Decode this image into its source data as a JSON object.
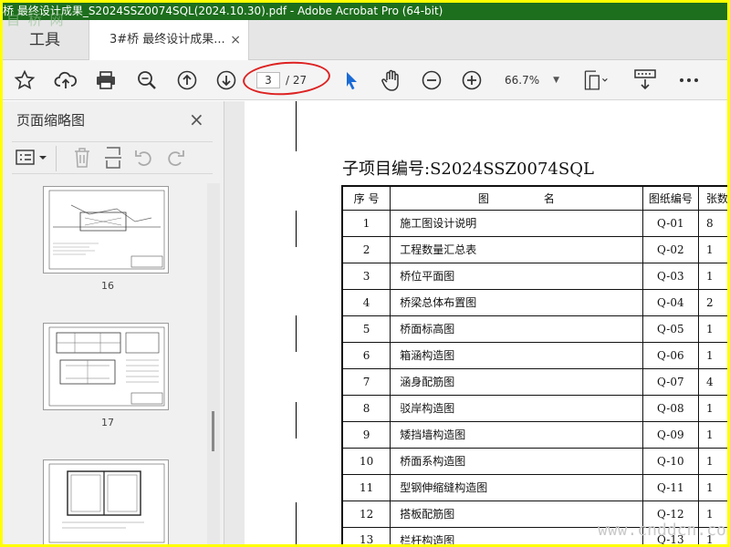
{
  "window": {
    "title": "桥 最终设计成果_S2024SSZ0074SQL(2024.10.30).pdf - Adobe Acrobat Pro (64-bit)",
    "watermark_top": "自 桥 网"
  },
  "tabs": {
    "tools_label": "工具",
    "doc_label": "3#桥 最终设计成果...",
    "close": "×"
  },
  "toolbar": {
    "page_current": "3",
    "page_total": "/ 27",
    "zoom": "66.7%",
    "highlight_color": "#dd2222",
    "icons": [
      "star-icon",
      "cloud-upload-icon",
      "print-icon",
      "search-zoom-icon",
      "page-up-icon",
      "page-down-icon",
      "select-arrow-icon",
      "hand-icon",
      "zoom-out-icon",
      "zoom-in-icon",
      "page-layout-icon",
      "form-icon",
      "more-icon"
    ]
  },
  "panel": {
    "title": "页面缩略图",
    "close": "×",
    "thumbnails": [
      {
        "label": "16"
      },
      {
        "label": "17"
      },
      {
        "label": ""
      }
    ]
  },
  "document": {
    "sheet_title": "子项目编号:S2024SSZ0074SQL",
    "headers": {
      "no": "序 号",
      "name": "图　　　　　名",
      "code": "图纸编号",
      "count": "张数"
    },
    "rows": [
      {
        "no": "1",
        "name": "施工图设计说明",
        "code": "Q-01",
        "count": "8"
      },
      {
        "no": "2",
        "name": "工程数量汇总表",
        "code": "Q-02",
        "count": "1"
      },
      {
        "no": "3",
        "name": "桥位平面图",
        "code": "Q-03",
        "count": "1"
      },
      {
        "no": "4",
        "name": "桥梁总体布置图",
        "code": "Q-04",
        "count": "2"
      },
      {
        "no": "5",
        "name": "桥面标高图",
        "code": "Q-05",
        "count": "1"
      },
      {
        "no": "6",
        "name": "箱涵构造图",
        "code": "Q-06",
        "count": "1"
      },
      {
        "no": "7",
        "name": "涵身配筋图",
        "code": "Q-07",
        "count": "4"
      },
      {
        "no": "8",
        "name": "驳岸构造图",
        "code": "Q-08",
        "count": "1"
      },
      {
        "no": "9",
        "name": "矮挡墙构造图",
        "code": "Q-09",
        "count": "1"
      },
      {
        "no": "10",
        "name": "桥面系构造图",
        "code": "Q-10",
        "count": "1"
      },
      {
        "no": "11",
        "name": "型钢伸缩缝构造图",
        "code": "Q-11",
        "count": "1"
      },
      {
        "no": "12",
        "name": "搭板配筋图",
        "code": "Q-12",
        "count": "1"
      },
      {
        "no": "13",
        "name": "栏杆构造图",
        "code": "Q-13",
        "count": "1"
      }
    ],
    "watermark": "www.cnddcn.com"
  }
}
